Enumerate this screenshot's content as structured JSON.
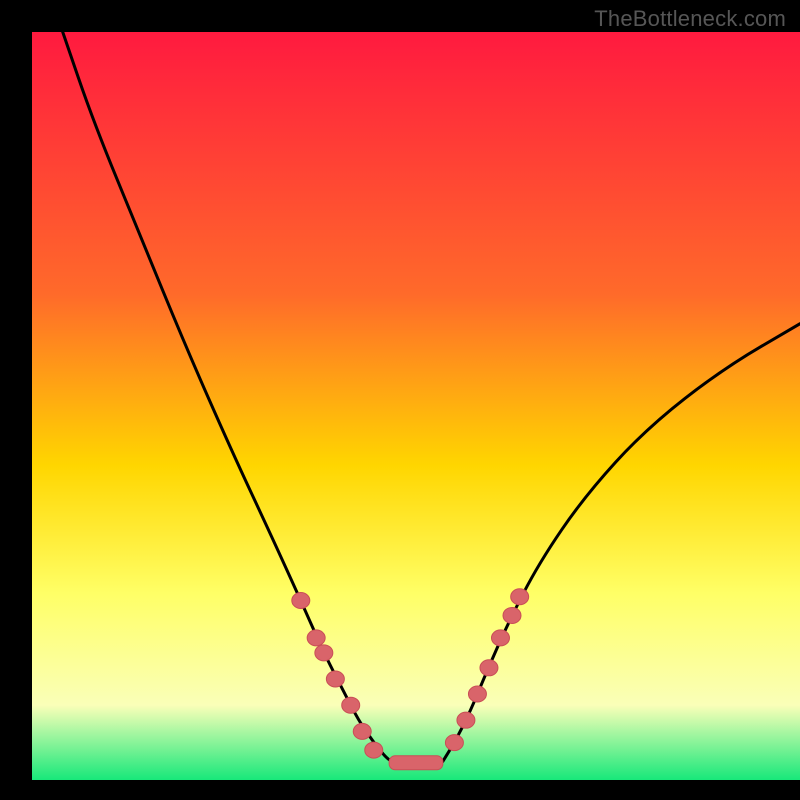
{
  "watermark": "TheBottleneck.com",
  "colors": {
    "background": "#000000",
    "gradient_top": "#ff1a3f",
    "gradient_mid1": "#ff6a2a",
    "gradient_mid2": "#ffd600",
    "gradient_mid3": "#ffff66",
    "gradient_mid4": "#faffb8",
    "gradient_bottom": "#17e87a",
    "curve": "#000000",
    "marker_fill": "#d9646a",
    "marker_stroke": "#c94e56"
  },
  "chart_data": {
    "type": "line",
    "title": "",
    "xlabel": "",
    "ylabel": "",
    "xlim": [
      0,
      100
    ],
    "ylim": [
      0,
      100
    ],
    "grid": false,
    "legend": false,
    "series": [
      {
        "name": "curve-left",
        "x": [
          4,
          8,
          14,
          20,
          26,
          31,
          35,
          38,
          40.5,
          42.5,
          44.5,
          46.5
        ],
        "values": [
          100,
          88,
          73,
          58,
          44,
          33,
          24,
          17,
          12,
          8,
          5,
          2.5
        ]
      },
      {
        "name": "curve-right",
        "x": [
          53.5,
          55,
          57,
          59,
          62,
          66,
          72,
          80,
          90,
          100
        ],
        "values": [
          2.5,
          5,
          9,
          14,
          21,
          29,
          38,
          47,
          55,
          61
        ]
      },
      {
        "name": "flat-bottom",
        "x": [
          46.5,
          48,
          50,
          52,
          53.5
        ],
        "values": [
          2.5,
          2.1,
          2,
          2.1,
          2.5
        ]
      }
    ],
    "markers_left": [
      {
        "x": 35,
        "y": 24
      },
      {
        "x": 37,
        "y": 19
      },
      {
        "x": 38,
        "y": 17
      },
      {
        "x": 39.5,
        "y": 13.5
      },
      {
        "x": 41.5,
        "y": 10
      },
      {
        "x": 43,
        "y": 6.5
      },
      {
        "x": 44.5,
        "y": 4
      }
    ],
    "markers_right": [
      {
        "x": 55,
        "y": 5
      },
      {
        "x": 56.5,
        "y": 8
      },
      {
        "x": 58,
        "y": 11.5
      },
      {
        "x": 59.5,
        "y": 15
      },
      {
        "x": 61,
        "y": 19
      },
      {
        "x": 62.5,
        "y": 22
      },
      {
        "x": 63.5,
        "y": 24.5
      }
    ],
    "bottom_segment": {
      "x1": 46.5,
      "x2": 53.5,
      "y": 2.3
    }
  }
}
